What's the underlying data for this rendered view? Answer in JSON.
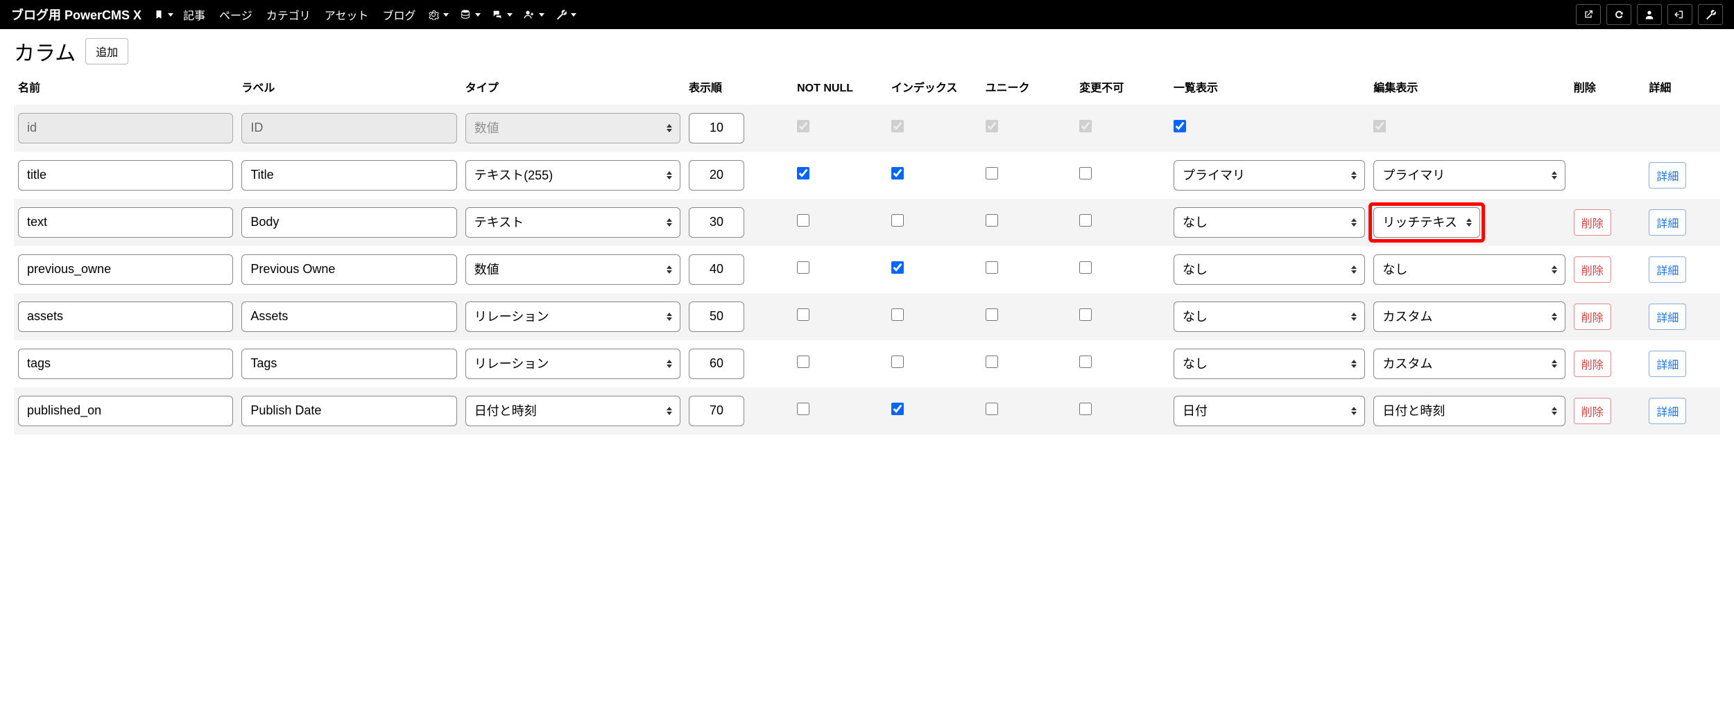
{
  "topbar": {
    "brand": "ブログ用 PowerCMS X",
    "nav": [
      "記事",
      "ページ",
      "カテゴリ",
      "アセット",
      "ブログ"
    ]
  },
  "section": {
    "title": "カラム",
    "add_button": "追加"
  },
  "headers": {
    "name": "名前",
    "label": "ラベル",
    "type": "タイプ",
    "order": "表示順",
    "not_null": "NOT NULL",
    "index": "インデックス",
    "unique": "ユニーク",
    "unchangeable": "変更不可",
    "list_display": "一覧表示",
    "edit_display": "編集表示",
    "delete": "削除",
    "detail": "詳細"
  },
  "buttons": {
    "delete": "削除",
    "detail": "詳細"
  },
  "rows": [
    {
      "name": "id",
      "label": "ID",
      "type": "数値",
      "order": "10",
      "not_null": true,
      "not_null_disabled": true,
      "index": true,
      "index_disabled": true,
      "unique": true,
      "unique_disabled": true,
      "unchangeable": true,
      "unchangeable_disabled": true,
      "list_display_checked": true,
      "edit_display_checked": true,
      "edit_display_disabled": true,
      "list_display_select": null,
      "edit_display_select": null,
      "show_delete": false,
      "show_detail": false,
      "locked": true
    },
    {
      "name": "title",
      "label": "Title",
      "type": "テキスト(255)",
      "order": "20",
      "not_null": true,
      "index": true,
      "unique": false,
      "unchangeable": false,
      "list_display_select": "プライマリ",
      "edit_display_select": "プライマリ",
      "show_delete": false,
      "show_detail": true
    },
    {
      "name": "text",
      "label": "Body",
      "type": "テキスト",
      "order": "30",
      "not_null": false,
      "index": false,
      "unique": false,
      "unchangeable": false,
      "list_display_select": "なし",
      "edit_display_select": "リッチテキス",
      "show_delete": true,
      "show_detail": true,
      "highlight_edit": true
    },
    {
      "name": "previous_owne",
      "label": "Previous Owne",
      "type": "数値",
      "order": "40",
      "not_null": false,
      "index": true,
      "unique": false,
      "unchangeable": false,
      "list_display_select": "なし",
      "edit_display_select": "なし",
      "show_delete": true,
      "show_detail": true
    },
    {
      "name": "assets",
      "label": "Assets",
      "type": "リレーション",
      "order": "50",
      "not_null": false,
      "index": false,
      "unique": false,
      "unchangeable": false,
      "list_display_select": "なし",
      "edit_display_select": "カスタム",
      "show_delete": true,
      "show_detail": true
    },
    {
      "name": "tags",
      "label": "Tags",
      "type": "リレーション",
      "order": "60",
      "not_null": false,
      "index": false,
      "unique": false,
      "unchangeable": false,
      "list_display_select": "なし",
      "edit_display_select": "カスタム",
      "show_delete": true,
      "show_detail": true
    },
    {
      "name": "published_on",
      "label": "Publish Date",
      "type": "日付と時刻",
      "order": "70",
      "not_null": false,
      "index": true,
      "unique": false,
      "unchangeable": false,
      "list_display_select": "日付",
      "edit_display_select": "日付と時刻",
      "show_delete": true,
      "show_detail": true
    }
  ]
}
